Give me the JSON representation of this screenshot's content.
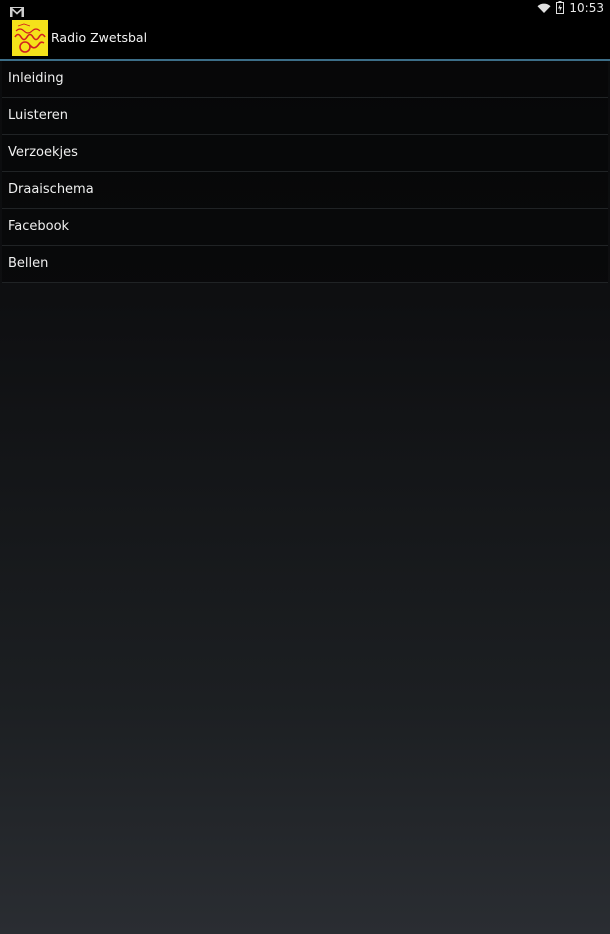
{
  "status_bar": {
    "time": "10:53",
    "icons": [
      "gmail-icon",
      "wifi-icon",
      "battery-charging-icon"
    ]
  },
  "action_bar": {
    "title": "Radio Zwetsbal",
    "logo_icon": "radio-zwetsbal-logo"
  },
  "menu": {
    "items": [
      {
        "label": "Inleiding"
      },
      {
        "label": "Luisteren"
      },
      {
        "label": "Verzoekjes"
      },
      {
        "label": "Draaischema"
      },
      {
        "label": "Facebook"
      },
      {
        "label": "Bellen"
      }
    ]
  },
  "colors": {
    "accent": "#3c6e88",
    "logo_background": "#f5e21a",
    "logo_ink": "#d22020"
  }
}
